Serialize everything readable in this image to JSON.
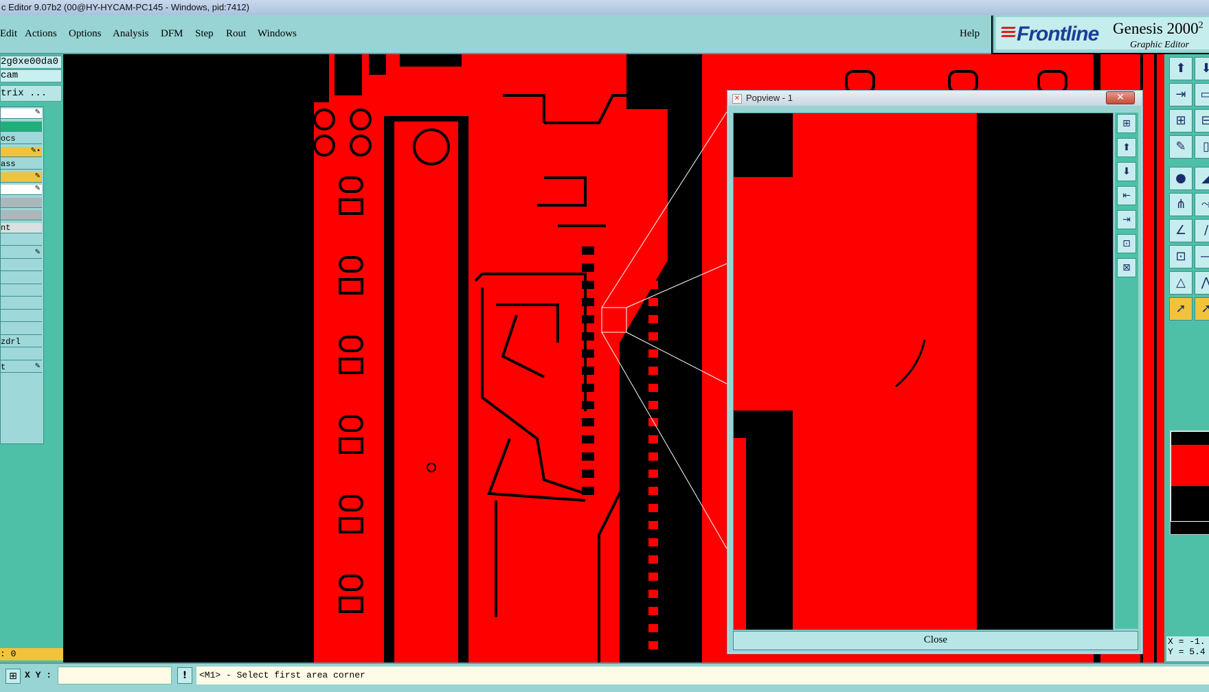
{
  "window": {
    "title": "c Editor 9.07b2 (00@HY-HYCAM-PC145 - Windows, pid:7412)"
  },
  "menubar": {
    "items": [
      "Edit",
      "Actions",
      "Options",
      "Analysis",
      "DFM",
      "Step",
      "Rout",
      "Windows"
    ],
    "help_label": "Help"
  },
  "brand": {
    "logo": "Frontline",
    "product": "Genesis 2000",
    "product_super": "2",
    "subtitle": "Graphic Editor"
  },
  "left_panel": {
    "job_field": "2g0xe00da0",
    "step_field": "cam",
    "matrix_button": "trix ...",
    "layers": [
      {
        "label": "",
        "color": "#ffffff",
        "mark": "✎"
      },
      {
        "label": "",
        "color": "#1fb07a",
        "mark": ""
      },
      {
        "label": "ocs",
        "color": "#9ed8d8",
        "mark": ""
      },
      {
        "label": "",
        "color": "#f1c23c",
        "mark": "✎▪"
      },
      {
        "label": "ass",
        "color": "#9ed8d8",
        "mark": ""
      },
      {
        "label": "",
        "color": "#f1c23c",
        "mark": "✎"
      },
      {
        "label": "",
        "color": "#ffffff",
        "mark": "✎"
      },
      {
        "label": "",
        "color": "#aab8bc",
        "mark": ""
      },
      {
        "label": "",
        "color": "#aab8bc",
        "mark": ""
      },
      {
        "label": "nt",
        "color": "#d8e0e0",
        "mark": ""
      },
      {
        "label": "",
        "color": "#9ed8d8",
        "mark": ""
      },
      {
        "label": "",
        "color": "#9ed8d8",
        "mark": "✎"
      },
      {
        "label": "",
        "color": "#9ed8d8",
        "mark": ""
      },
      {
        "label": "",
        "color": "#9ed8d8",
        "mark": ""
      },
      {
        "label": "",
        "color": "#9ed8d8",
        "mark": ""
      },
      {
        "label": "",
        "color": "#9ed8d8",
        "mark": ""
      },
      {
        "label": "",
        "color": "#9ed8d8",
        "mark": ""
      },
      {
        "label": "",
        "color": "#9ed8d8",
        "mark": ""
      },
      {
        "label": "zdrl",
        "color": "#9ed8d8",
        "mark": ""
      },
      {
        "label": "",
        "color": "#9ed8d8",
        "mark": ""
      },
      {
        "label": "t",
        "color": "#9ed8d8",
        "mark": "✎"
      }
    ],
    "counter": ": 0"
  },
  "popview": {
    "title": "Popview - 1",
    "close_x": "✕",
    "close_button": "Close",
    "tool_icons": [
      "fit-icon",
      "zoom-in-icon",
      "zoom-out-icon",
      "pan-left-icon",
      "pan-right-icon",
      "zoom-home-icon",
      "zoom-window-icon"
    ]
  },
  "right_toolbar": {
    "tool_icons": [
      "export-icon",
      "import-icon",
      "frame-icon",
      "zoom-icon",
      "measure-icon",
      "pad-icon",
      "net-icon",
      "route-icon",
      "slice-icon",
      "triangle-icon",
      "select-arrow-icon"
    ],
    "coords": {
      "x": "X = -1.",
      "y": "Y = 5.4"
    }
  },
  "statusbar": {
    "xy_label": "X Y :",
    "xy_value": "",
    "message": "<M1> - Select first area corner"
  },
  "colors": {
    "copper": "#ff0000",
    "background": "#000000",
    "panel": "#98d4d4",
    "panel_dark": "#4ec0a8"
  }
}
